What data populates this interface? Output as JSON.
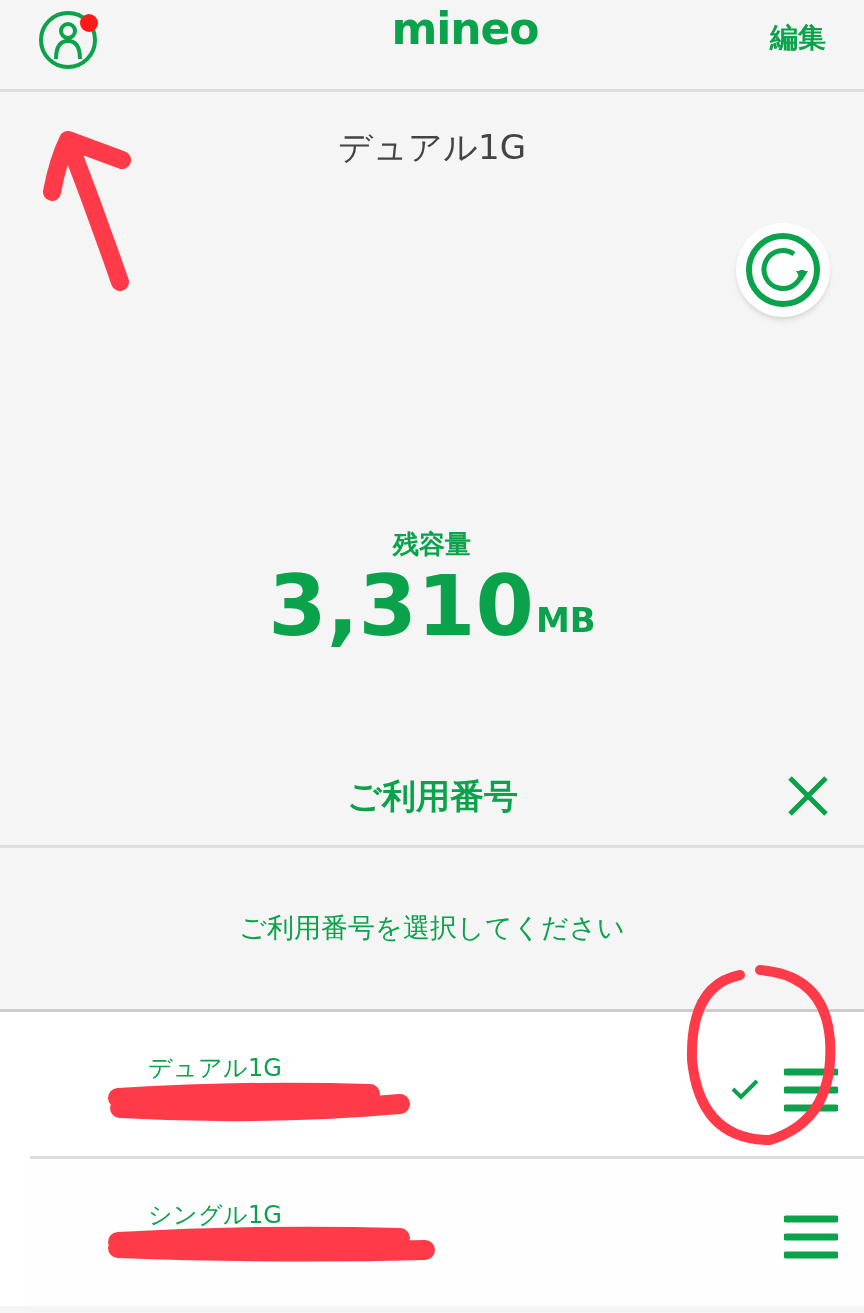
{
  "header": {
    "logo": "mineo",
    "edit": "編集",
    "notification": true
  },
  "plan_name": "デュアル1G",
  "remaining": {
    "label": "残容量",
    "value": "3,310",
    "unit": "MB"
  },
  "sheet": {
    "title": "ご利用番号",
    "prompt": "ご利用番号を選択してください",
    "lines": [
      {
        "name": "デュアル1G",
        "selected": true
      },
      {
        "name": "シングル1G",
        "selected": false
      }
    ]
  }
}
